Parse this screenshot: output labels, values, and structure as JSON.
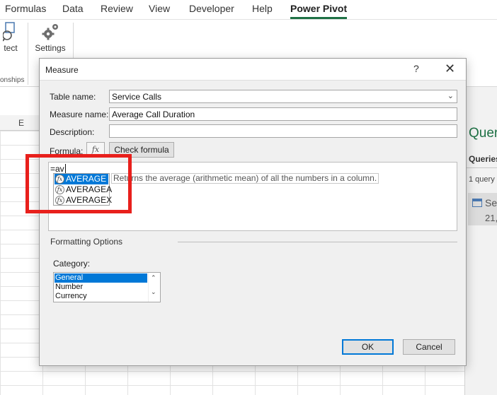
{
  "ribbon": {
    "tabs": [
      "Formulas",
      "Data",
      "Review",
      "View",
      "Developer",
      "Help",
      "Power Pivot"
    ],
    "active_tab": "Power Pivot",
    "buttons": {
      "detect_label": "tect",
      "settings_label": "Settings"
    },
    "group_label": "onships"
  },
  "sheet": {
    "column_header": "E"
  },
  "queries_pane": {
    "title": "Queri",
    "tab_label": "Queries",
    "count": "1 query",
    "item_name": "Ser",
    "item_rows": "21,"
  },
  "dialog": {
    "title": "Measure",
    "help_symbol": "?",
    "close_symbol": "✕",
    "table_name_label": "Table name:",
    "table_name_value": "Service Calls",
    "measure_name_label": "Measure name:",
    "measure_name_value": "Average Call Duration",
    "description_label": "Description:",
    "description_value": "",
    "formula_label": "Formula:",
    "fx_label": "fx",
    "check_formula_label": "Check formula",
    "formula_text": "=av",
    "autocomplete": {
      "items": [
        "AVERAGE",
        "AVERAGEA",
        "AVERAGEX"
      ],
      "selected": "AVERAGE",
      "tooltip": "Returns the average (arithmetic mean) of all the numbers in a column."
    },
    "formatting_title": "Formatting Options",
    "category_label": "Category:",
    "categories": [
      "General",
      "Number",
      "Currency"
    ],
    "selected_category": "General",
    "ok_label": "OK",
    "cancel_label": "Cancel",
    "highlight_color": "#e8201c",
    "accent_color": "#0078d7"
  }
}
